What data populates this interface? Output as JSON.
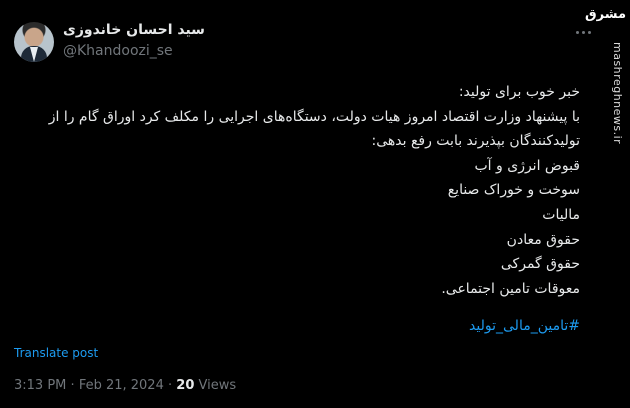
{
  "author": {
    "display_name": "سید احسان خاندوزی",
    "handle": "@Khandoozi_se"
  },
  "tweet": {
    "lines": [
      "خبر خوب برای تولید:",
      "با پیشنهاد وزارت اقتصاد امروز هیات دولت، دستگاه‌های اجرایی را مکلف کرد اوراق گام را از",
      "تولیدکنندگان بپذیرند بابت رفع بدهی:",
      "قبوض انرژی و آب",
      "سوخت و خوراک صنایع",
      "مالیات",
      "حقوق معادن",
      "حقوق گمرکی",
      "معوقات تامین اجتماعی."
    ],
    "hashtag": "#تامین_مالی_تولید"
  },
  "translate_label": "Translate post",
  "meta": {
    "time": "3:13 PM",
    "separator": "·",
    "date": "Feb 21, 2024",
    "views_count": "20",
    "views_label": "Views"
  },
  "watermark": {
    "logo_text": "مشرق",
    "site": "mashreghnews.ir"
  }
}
